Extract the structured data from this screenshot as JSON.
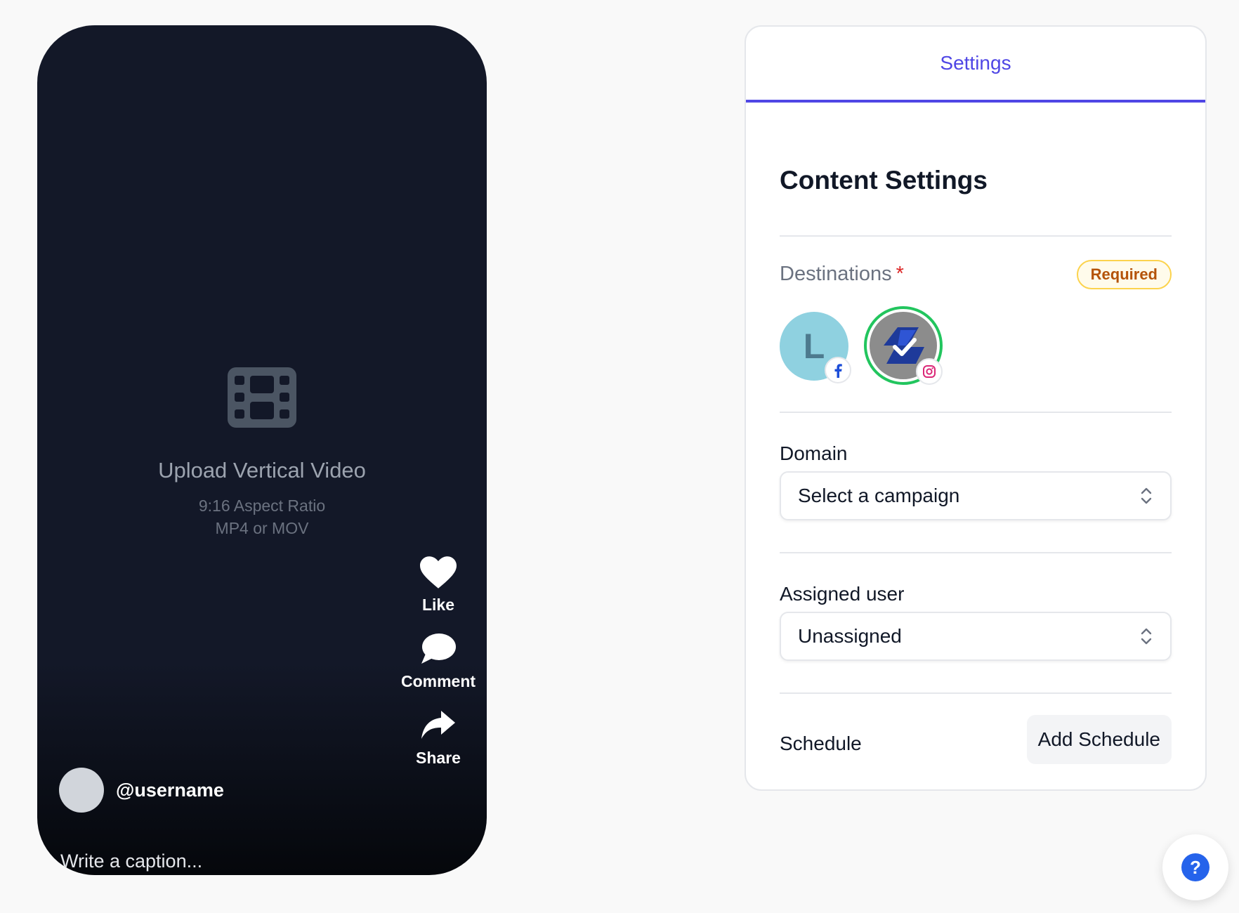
{
  "preview": {
    "upload_title": "Upload Vertical Video",
    "aspect_ratio": "9:16 Aspect Ratio",
    "formats": "MP4 or MOV",
    "icons": {
      "upload": "film-icon",
      "like": "heart-icon",
      "comment": "comment-bubble-icon",
      "share": "share-arrow-icon"
    },
    "actions": {
      "like": "Like",
      "comment": "Comment",
      "share": "Share"
    },
    "username": "@username",
    "caption_placeholder": "Write a caption..."
  },
  "panel": {
    "tab": "Settings",
    "title": "Content Settings",
    "destinations": {
      "label": "Destinations",
      "required_star": "*",
      "badge": "Required",
      "accounts": [
        {
          "avatar_letter": "L",
          "network": "facebook",
          "network_icon": "facebook-icon",
          "selected": false
        },
        {
          "avatar_icon": "brand-logo-icon",
          "network": "instagram",
          "network_icon": "instagram-icon",
          "selected": true
        }
      ]
    },
    "domain": {
      "label": "Domain",
      "value": "Select a campaign"
    },
    "assigned_user": {
      "label": "Assigned user",
      "value": "Unassigned"
    },
    "schedule": {
      "label": "Schedule",
      "button": "Add Schedule"
    }
  },
  "help": {
    "label": "?",
    "icon": "help-icon"
  },
  "colors": {
    "accent": "#4f46e5",
    "phone_bg": "#131828",
    "selected_ring": "#22c55e",
    "required_text": "#b45309",
    "required_bg": "#fffbeb",
    "star": "#dc2626",
    "help": "#2563eb"
  }
}
